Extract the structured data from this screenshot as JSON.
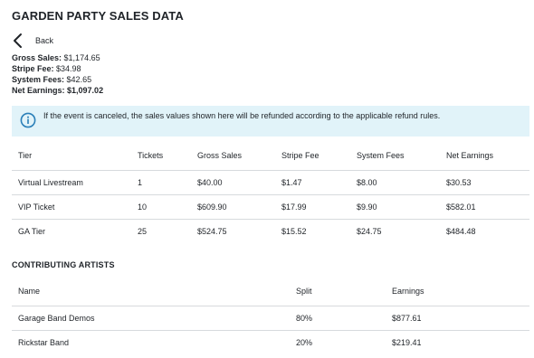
{
  "page": {
    "title": "GARDEN PARTY SALES DATA",
    "back_label": "Back"
  },
  "summary": {
    "gross_sales_label": "Gross Sales:",
    "gross_sales_value": "$1,174.65",
    "stripe_fee_label": "Stripe Fee:",
    "stripe_fee_value": "$34.98",
    "system_fees_label": "System Fees:",
    "system_fees_value": "$42.65",
    "net_earnings_label": "Net Earnings:",
    "net_earnings_value": "$1,097.02"
  },
  "info": {
    "icon": "info-icon",
    "message": "If the event is canceled, the sales values shown here will be refunded according to the applicable refund rules.",
    "bg_color": "#e1f3f9",
    "icon_color": "#2a7fb8"
  },
  "tiers": {
    "headers": [
      "Tier",
      "Tickets",
      "Gross Sales",
      "Stripe Fee",
      "System Fees",
      "Net Earnings"
    ],
    "rows": [
      [
        "Virtual Livestream",
        "1",
        "$40.00",
        "$1.47",
        "$8.00",
        "$30.53"
      ],
      [
        "VIP Ticket",
        "10",
        "$609.90",
        "$17.99",
        "$9.90",
        "$582.01"
      ],
      [
        "GA Tier",
        "25",
        "$524.75",
        "$15.52",
        "$24.75",
        "$484.48"
      ]
    ]
  },
  "artists": {
    "title": "CONTRIBUTING ARTISTS",
    "headers": [
      "Name",
      "Split",
      "Earnings"
    ],
    "rows": [
      [
        "Garage Band Demos",
        "80%",
        "$877.61"
      ],
      [
        "Rickstar Band",
        "20%",
        "$219.41"
      ]
    ]
  }
}
